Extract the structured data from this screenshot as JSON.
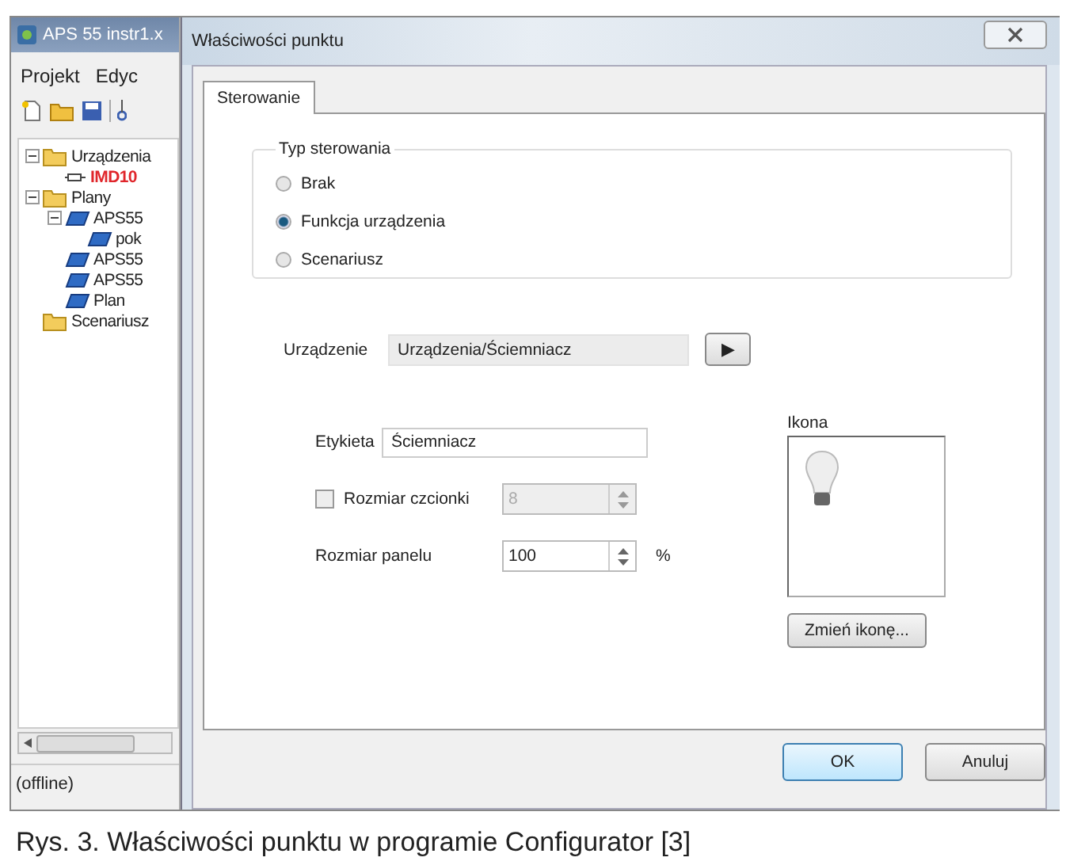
{
  "main_window": {
    "title": "APS 55 instr1.x",
    "menu": [
      "Projekt",
      "Edyc"
    ],
    "tree": [
      {
        "label": "Urządzenia",
        "kind": "folder",
        "expanded": true,
        "children": [
          {
            "label": "IMD10",
            "kind": "device"
          }
        ]
      },
      {
        "label": "Plany",
        "kind": "folder",
        "expanded": true,
        "children": [
          {
            "label": "APS55",
            "kind": "plan",
            "expanded": true,
            "children": [
              {
                "label": "pok",
                "kind": "plan"
              }
            ]
          },
          {
            "label": "APS55",
            "kind": "plan"
          },
          {
            "label": "APS55",
            "kind": "plan"
          },
          {
            "label": "Plan",
            "kind": "plan"
          }
        ]
      },
      {
        "label": "Scenariusz",
        "kind": "folder"
      }
    ],
    "status_bar": "(offline)"
  },
  "dialog": {
    "title": "Właściwości punktu",
    "tabs": [
      {
        "label": "Sterowanie",
        "selected": true
      }
    ],
    "group": {
      "title": "Typ sterowania",
      "options": [
        {
          "label": "Brak",
          "selected": false
        },
        {
          "label": "Funkcja urządzenia",
          "selected": true
        },
        {
          "label": "Scenariusz",
          "selected": false
        }
      ]
    },
    "device": {
      "label": "Urządzenie",
      "value": "Urządzenia/Ściemniacz",
      "button": "▶"
    },
    "label_field": {
      "label": "Etykieta",
      "value": "Ściemniacz"
    },
    "font_size": {
      "label": "Rozmiar czcionki",
      "checked": false,
      "value": "8"
    },
    "panel_size": {
      "label": "Rozmiar panelu",
      "value": "100",
      "unit": "%"
    },
    "icon": {
      "label": "Ikona",
      "button": "Zmień ikonę..."
    },
    "buttons": [
      "OK",
      "Anuluj"
    ]
  },
  "caption": "Rys. 3. Właściwości punktu w programie Configurator [3]"
}
